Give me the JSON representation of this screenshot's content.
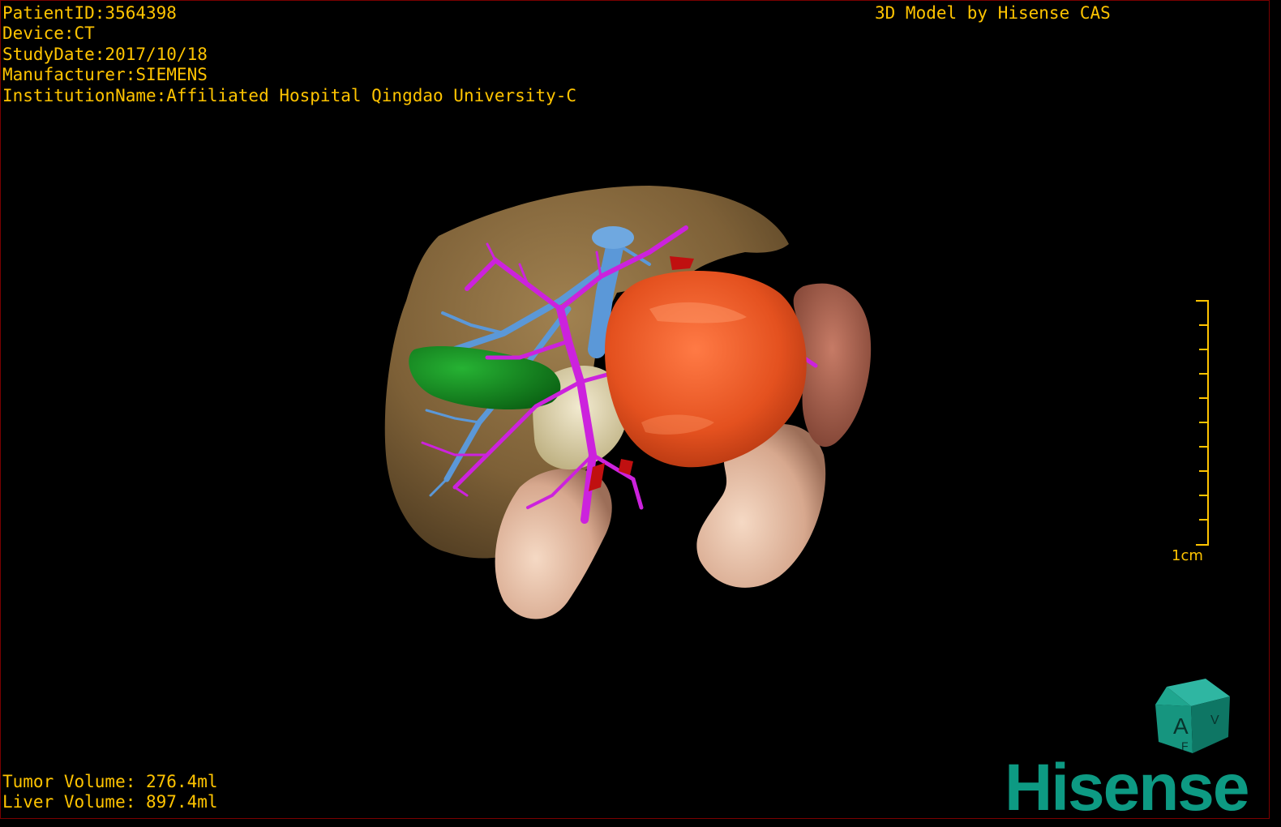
{
  "header": {
    "patient_id": "PatientID:3564398",
    "device": "Device:CT",
    "study_date": "StudyDate:2017/10/18",
    "manufacturer": "Manufacturer:SIEMENS",
    "institution": "InstitutionName:Affiliated Hospital Qingdao University-C"
  },
  "credit": "3D Model by Hisense CAS",
  "volumes": {
    "tumor": "Tumor Volume: 276.4ml",
    "liver": "Liver Volume: 897.4ml"
  },
  "scale": {
    "label": "1cm"
  },
  "orientation_cube": {
    "face_front": "A",
    "face_side": "V",
    "face_bottom": "F"
  },
  "logo": {
    "text": "Hisense"
  },
  "colors": {
    "overlay_text": "#ffc400",
    "liver": "#8a6a3e",
    "tumor": "#e8542a",
    "gallbladder": "#0f8a1c",
    "portal_vein": "#cc22dd",
    "hepatic_vein": "#5b98d8",
    "kidney": "#e9c2a8",
    "spleen": "#a85f4c",
    "pancreas": "#e6dcae",
    "artery": "#c01010",
    "logo": "#0d9a83"
  },
  "icons": [
    "orientation-cube-icon",
    "scale-bar-icon"
  ]
}
